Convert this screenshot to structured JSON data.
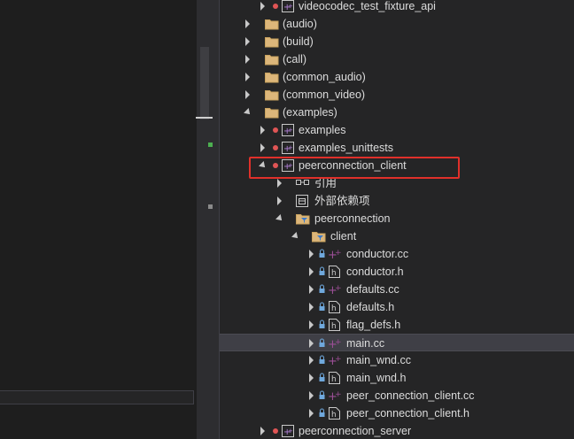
{
  "tree": {
    "items": [
      {
        "label": "videocodec_test_fixture_api",
        "kind": "project"
      },
      {
        "label": "(audio)",
        "kind": "folder"
      },
      {
        "label": "(build)",
        "kind": "folder"
      },
      {
        "label": "(call)",
        "kind": "folder"
      },
      {
        "label": "(common_audio)",
        "kind": "folder"
      },
      {
        "label": "(common_video)",
        "kind": "folder"
      },
      {
        "label": "(examples)",
        "kind": "folder",
        "expanded": true
      },
      {
        "label": "examples",
        "kind": "project"
      },
      {
        "label": "examples_unittests",
        "kind": "project"
      },
      {
        "label": "peerconnection_client",
        "kind": "project",
        "expanded": true,
        "highlighted": true
      },
      {
        "label": "引用",
        "kind": "references"
      },
      {
        "label": "外部依赖项",
        "kind": "external-deps"
      },
      {
        "label": "peerconnection",
        "kind": "filter",
        "expanded": true
      },
      {
        "label": "client",
        "kind": "filter",
        "expanded": true
      },
      {
        "label": "conductor.cc",
        "kind": "cpp"
      },
      {
        "label": "conductor.h",
        "kind": "header"
      },
      {
        "label": "defaults.cc",
        "kind": "cpp"
      },
      {
        "label": "defaults.h",
        "kind": "header"
      },
      {
        "label": "flag_defs.h",
        "kind": "header"
      },
      {
        "label": "main.cc",
        "kind": "cpp",
        "selected": true
      },
      {
        "label": "main_wnd.cc",
        "kind": "cpp"
      },
      {
        "label": "main_wnd.h",
        "kind": "header"
      },
      {
        "label": "peer_connection_client.cc",
        "kind": "cpp"
      },
      {
        "label": "peer_connection_client.h",
        "kind": "header"
      },
      {
        "label": "peerconnection_server",
        "kind": "project"
      }
    ]
  },
  "colors": {
    "background": "#1e1e1e",
    "tree_background": "#252526",
    "selection": "#3f3f46",
    "highlight_box": "#e0302a",
    "folder": "#dcb67a",
    "cpp_plus": "#9b4f96",
    "project_icon": "#b180d7",
    "red_dot": "#e05555"
  }
}
